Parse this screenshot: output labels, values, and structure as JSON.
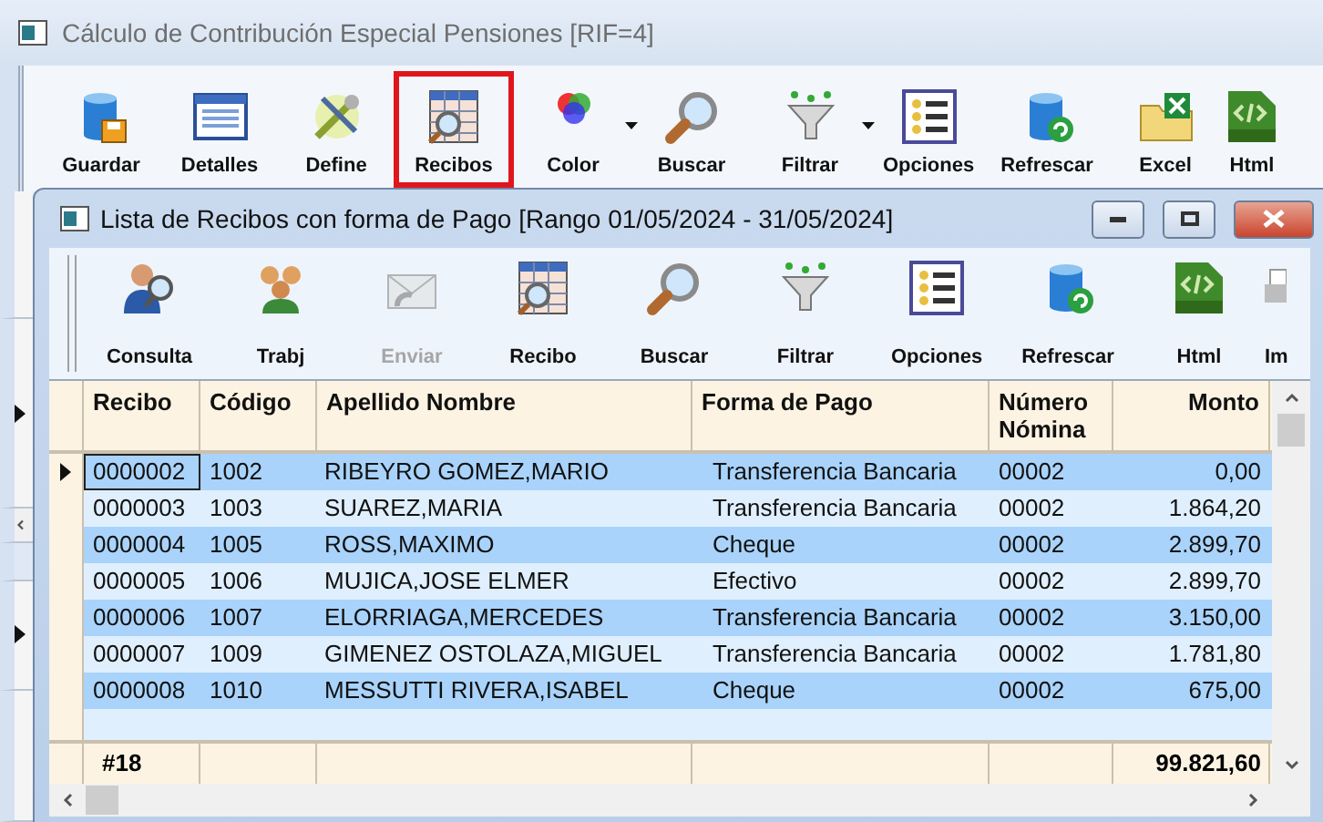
{
  "window": {
    "title": "Cálculo de Contribución Especial Pensiones [RIF=4]"
  },
  "toolbar": [
    {
      "label": "Guardar",
      "highlighted": false,
      "dropdown": false
    },
    {
      "label": "Detalles",
      "highlighted": false,
      "dropdown": false
    },
    {
      "label": "Define",
      "highlighted": false,
      "dropdown": false
    },
    {
      "label": "Recibos",
      "highlighted": true,
      "dropdown": false
    },
    {
      "label": "Color",
      "highlighted": false,
      "dropdown": true
    },
    {
      "label": "Buscar",
      "highlighted": false,
      "dropdown": false
    },
    {
      "label": "Filtrar",
      "highlighted": false,
      "dropdown": true
    },
    {
      "label": "Opciones",
      "highlighted": false,
      "dropdown": false
    },
    {
      "label": "Refrescar",
      "highlighted": false,
      "dropdown": false
    },
    {
      "label": "Excel",
      "highlighted": false,
      "dropdown": false
    },
    {
      "label": "Html",
      "highlighted": false,
      "dropdown": false
    }
  ],
  "child_window": {
    "title": "Lista de Recibos con forma de Pago [Rango 01/05/2024 - 31/05/2024]",
    "toolbar": [
      {
        "label": "Consulta",
        "disabled": false
      },
      {
        "label": "Trabj",
        "disabled": false
      },
      {
        "label": "Enviar",
        "disabled": true
      },
      {
        "label": "Recibo",
        "disabled": false
      },
      {
        "label": "Buscar",
        "disabled": false
      },
      {
        "label": "Filtrar",
        "disabled": false
      },
      {
        "label": "Opciones",
        "disabled": false
      },
      {
        "label": "Refrescar",
        "disabled": false
      },
      {
        "label": "Html",
        "disabled": false
      },
      {
        "label": "Im",
        "disabled": false
      }
    ],
    "table": {
      "columns": [
        "Recibo",
        "Código",
        "Apellido Nombre",
        "Forma de Pago",
        "Número Nómina",
        "Monto"
      ],
      "rows": [
        {
          "cells": [
            "0000002",
            "1002",
            "RIBEYRO GOMEZ,MARIO",
            "Transferencia Bancaria",
            "00002",
            "0,00"
          ],
          "selected": true
        },
        {
          "cells": [
            "0000003",
            "1003",
            "SUAREZ,MARIA",
            "Transferencia Bancaria",
            "00002",
            "1.864,20"
          ],
          "selected": false
        },
        {
          "cells": [
            "0000004",
            "1005",
            "ROSS,MAXIMO",
            "Cheque",
            "00002",
            "2.899,70"
          ],
          "selected": false
        },
        {
          "cells": [
            "0000005",
            "1006",
            "MUJICA,JOSE ELMER",
            "Efectivo",
            "00002",
            "2.899,70"
          ],
          "selected": false
        },
        {
          "cells": [
            "0000006",
            "1007",
            "ELORRIAGA,MERCEDES",
            "Transferencia Bancaria",
            "00002",
            "3.150,00"
          ],
          "selected": false
        },
        {
          "cells": [
            "0000007",
            "1009",
            "GIMENEZ OSTOLAZA,MIGUEL",
            "Transferencia Bancaria",
            "00002",
            "1.781,80"
          ],
          "selected": false
        },
        {
          "cells": [
            "0000008",
            "1010",
            "MESSUTTI RIVERA,ISABEL",
            "Cheque",
            "00002",
            "675,00"
          ],
          "selected": false
        }
      ],
      "footer": {
        "count": "#18",
        "total": "99.821,60"
      }
    }
  }
}
